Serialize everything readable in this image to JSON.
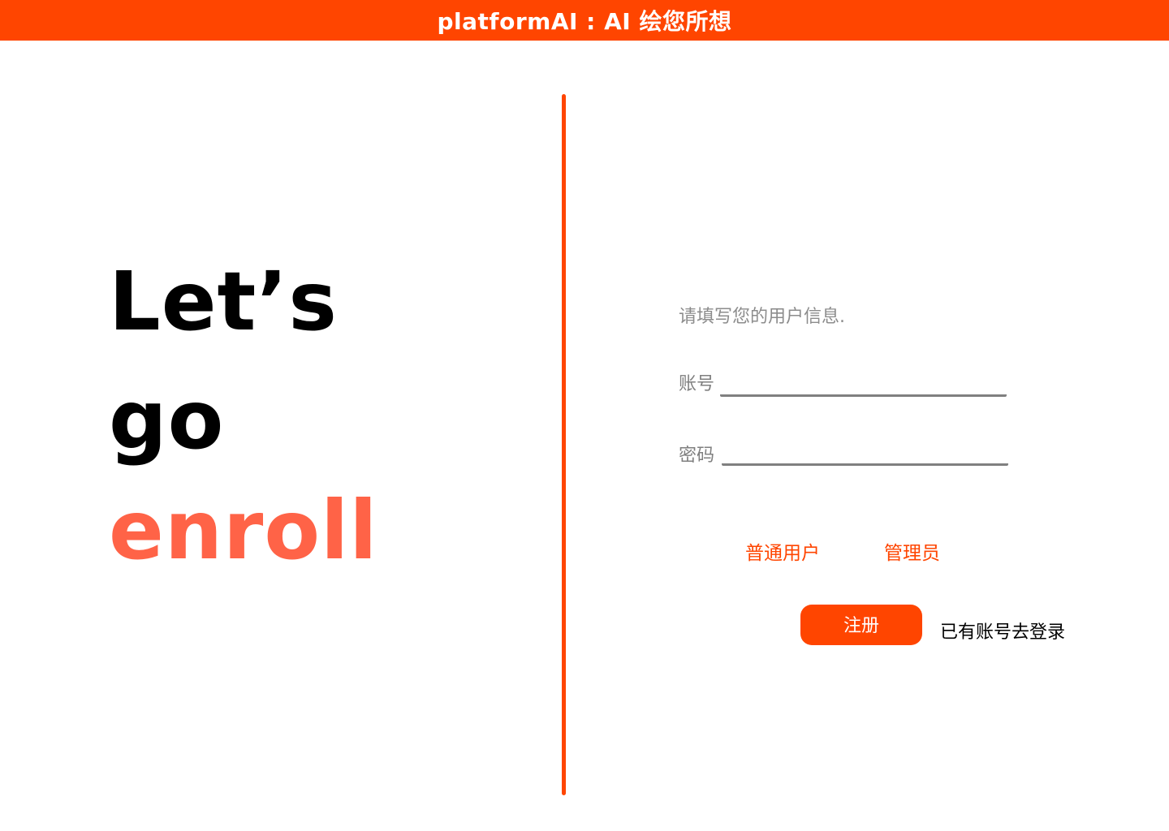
{
  "header": {
    "title": "platformAI : AI 绘您所想"
  },
  "hero": {
    "line1": "Let’s",
    "line2": "go",
    "line3": "enroll"
  },
  "form": {
    "prompt": "请填写您的用户信息.",
    "account_label": "账号",
    "account_value": "",
    "password_label": "密码",
    "password_value": "",
    "roles": [
      {
        "label": "普通用户"
      },
      {
        "label": "管理员"
      }
    ],
    "register_label": "注册",
    "login_link": "已有账号去登录"
  },
  "colors": {
    "accent": "#ff4500",
    "hero_accent": "#ff6347",
    "muted_text": "#8c8c8c",
    "underline": "#808080"
  }
}
